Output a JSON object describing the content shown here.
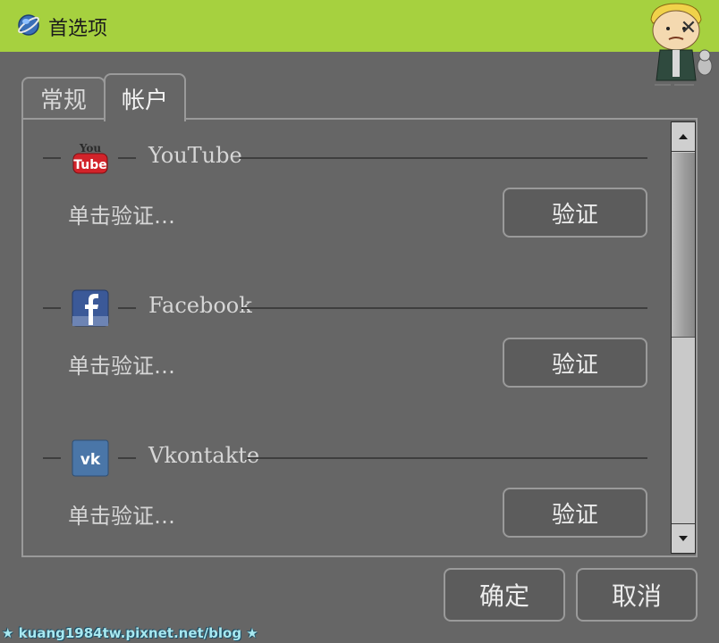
{
  "window": {
    "title": "首选项"
  },
  "tabs": [
    {
      "label": "常规",
      "active": false
    },
    {
      "label": "帐户",
      "active": true
    }
  ],
  "accounts": [
    {
      "service": "YouTube",
      "icon": "youtube-icon",
      "status": "单击验证…",
      "button_label": "验证"
    },
    {
      "service": "Facebook",
      "icon": "facebook-icon",
      "status": "单击验证…",
      "button_label": "验证"
    },
    {
      "service": "Vkontakte",
      "icon": "vkontakte-icon",
      "status": "单击验证…",
      "button_label": "验证"
    }
  ],
  "footer": {
    "ok_label": "确定",
    "cancel_label": "取消"
  },
  "watermark": "★ kuang1984tw.pixnet.net/blog ★",
  "colors": {
    "titlebar": "#a6d13f",
    "background": "#666666",
    "text": "#d6d6d6"
  }
}
